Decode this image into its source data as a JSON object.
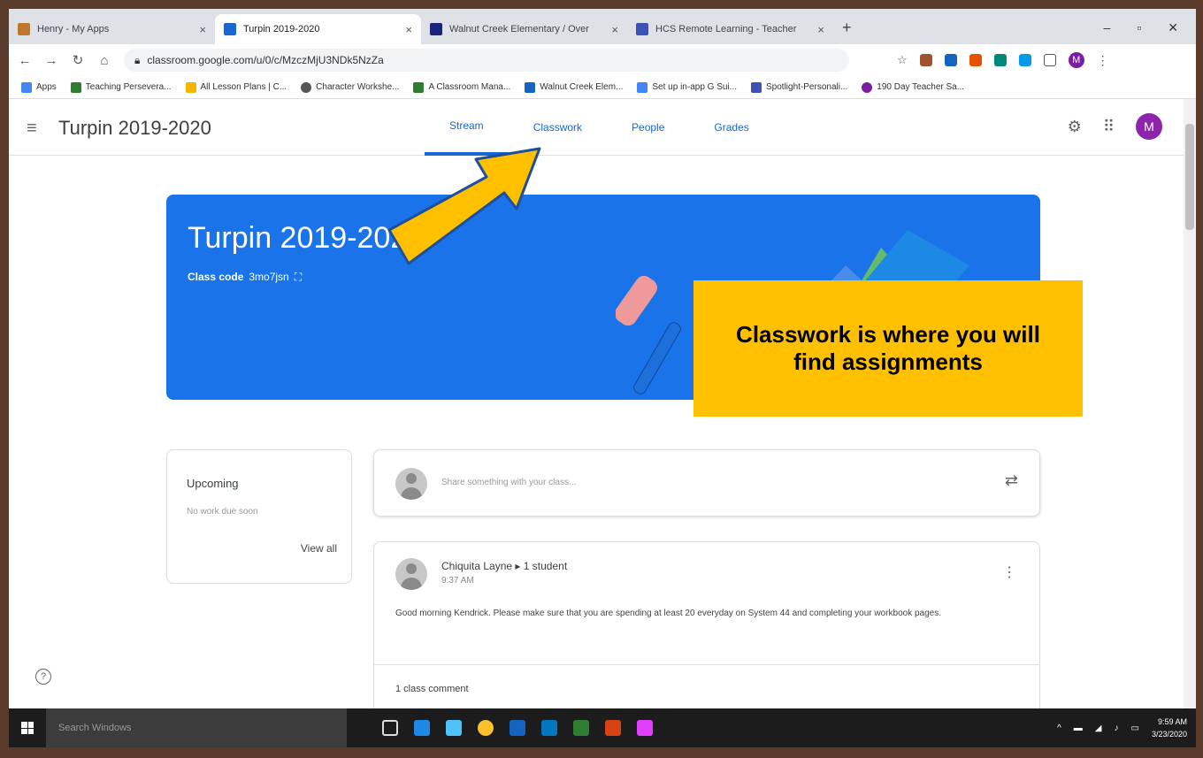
{
  "browser": {
    "tabs": [
      {
        "title": "Henry - My Apps",
        "color": "#c0762b"
      },
      {
        "title": "Turpin 2019-2020",
        "color": "#1967d2"
      },
      {
        "title": "Walnut Creek Elementary / Over",
        "color": "#1a237e"
      },
      {
        "title": "HCS Remote Learning - Teacher",
        "color": "#3f51b5"
      }
    ],
    "tab_close": "×",
    "new_tab": "+",
    "url": "classroom.google.com/u/0/c/MzczMjU3NDk5NzZa",
    "bookmarks": [
      {
        "label": "Apps",
        "color": "#4285f4"
      },
      {
        "label": "Teaching Persevera...",
        "color": "#2e7d32"
      },
      {
        "label": "All Lesson Plans | C...",
        "color": "#f4b400"
      },
      {
        "label": "Character Workshe...",
        "color": "#555555"
      },
      {
        "label": "A Classroom Mana...",
        "color": "#2e7d32"
      },
      {
        "label": "Walnut Creek Elem...",
        "color": "#1565c0"
      },
      {
        "label": "Set up in-app G Sui...",
        "color": "#4285f4"
      },
      {
        "label": "Spotlight-Personali...",
        "color": "#3f51b5"
      },
      {
        "label": "190 Day Teacher Sa...",
        "color": "#7b1fa2"
      }
    ],
    "profile_initial": "M"
  },
  "header": {
    "class_title": "Turpin 2019-2020",
    "tabs": [
      "Stream",
      "Classwork",
      "People",
      "Grades"
    ],
    "avatar_initial": "M"
  },
  "banner": {
    "title": "Turpin 2019-2020",
    "class_code_label": "Class code",
    "class_code": "3mo7jsn",
    "accent": "#1a73e8"
  },
  "callout": {
    "text": "Classwork is where you will find assignments",
    "color": "#ffc000"
  },
  "upcoming": {
    "title": "Upcoming",
    "subtitle": "No work due soon",
    "view_all": "View all"
  },
  "share": {
    "placeholder": "Share something with your class..."
  },
  "post": {
    "author": "Chiquita Layne",
    "audience": "1 student",
    "time": "9:37 AM",
    "body": "Good morning Kendrick. Please make sure that you are spending at least 20 everyday on System 44 and completing your workbook pages.",
    "comments": "1 class comment"
  },
  "taskbar": {
    "search_placeholder": "Search Windows",
    "time": "9:59 AM",
    "date": "3/23/2020"
  },
  "icons": {
    "help": "?",
    "menu": "≡",
    "gear": "⚙",
    "apps": "⠿",
    "more": "⋮",
    "repost": "⇄"
  }
}
